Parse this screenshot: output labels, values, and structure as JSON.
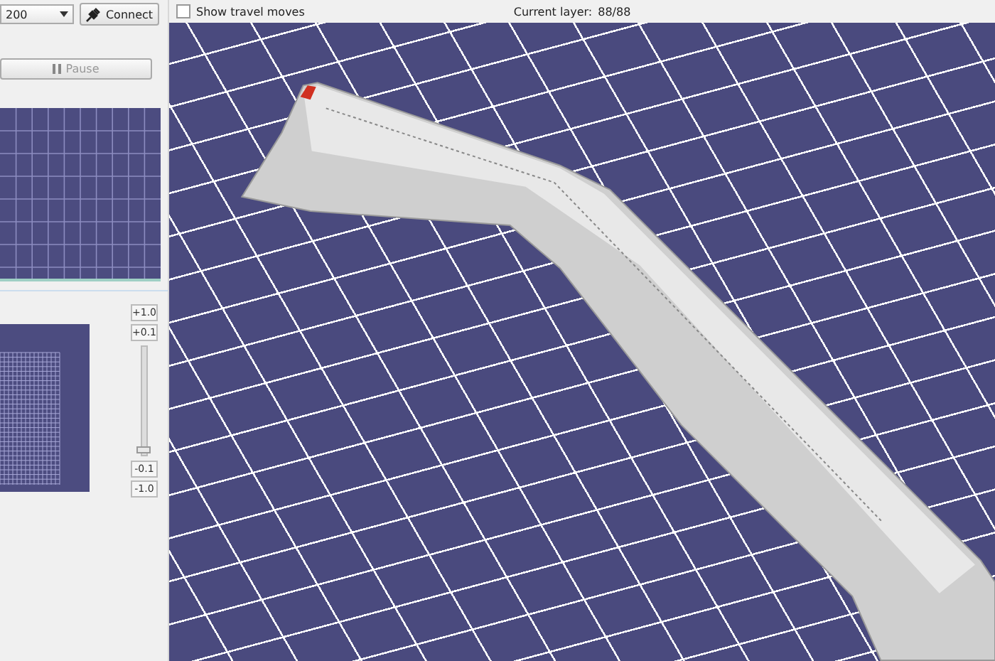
{
  "connection": {
    "port": "200",
    "connect_label": "Connect"
  },
  "pause_button": {
    "label": "Pause",
    "disabled": true
  },
  "z_controls": {
    "buttons": [
      "+1.0",
      "+0.1",
      "-0.1",
      "-1.0"
    ],
    "level": 0.04
  },
  "object_view": {
    "show_travel_moves": {
      "label": "Show travel moves",
      "checked": false
    },
    "current_layer_label": "Current layer:",
    "current_layer_value": "88/88"
  }
}
